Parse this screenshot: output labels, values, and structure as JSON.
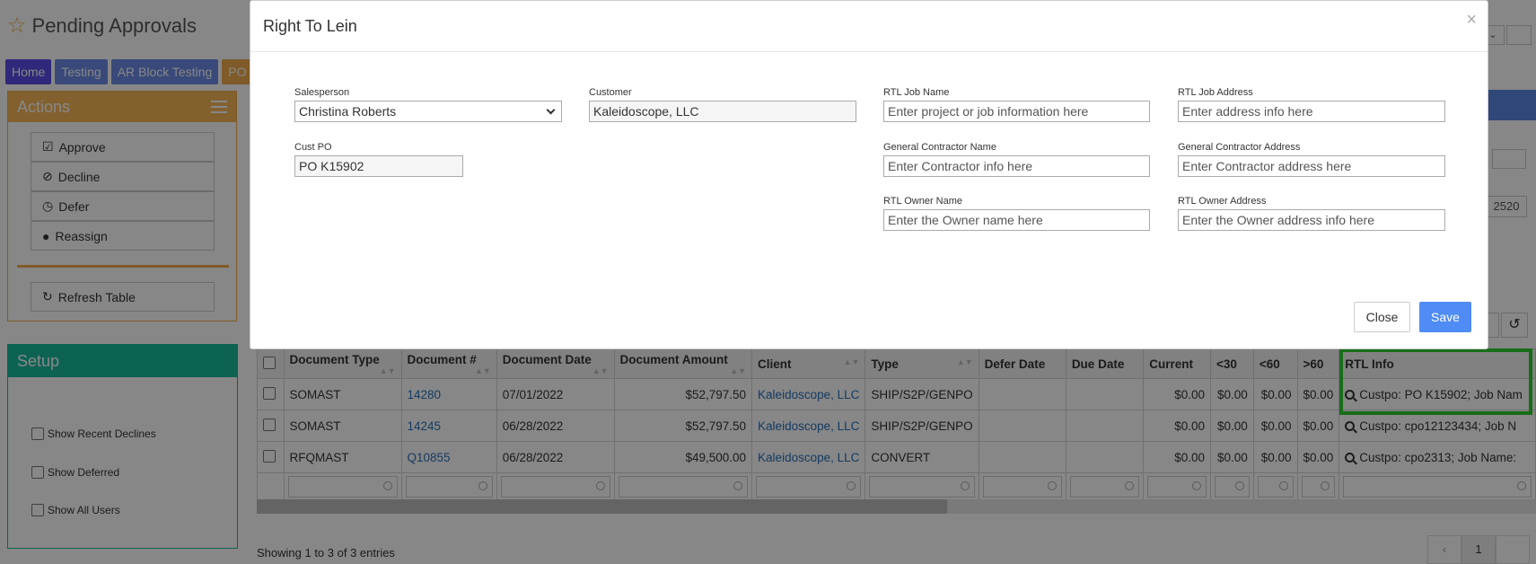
{
  "page": {
    "title": "Pending Approvals",
    "tabs": [
      "Home",
      "Testing",
      "AR Block Testing",
      "PO B"
    ]
  },
  "actions": {
    "title": "Actions",
    "approve": "Approve",
    "decline": "Decline",
    "defer": "Defer",
    "reassign": "Reassign",
    "refresh": "Refresh Table"
  },
  "setup": {
    "title": "Setup",
    "show_recent_declines": "Show Recent Declines",
    "show_deferred": "Show Deferred",
    "show_all_users": "Show All Users"
  },
  "side": {
    "number": "2520"
  },
  "table": {
    "headers": [
      "Document Type",
      "Document #",
      "Document Date",
      "Document Amount",
      "Client",
      "Type",
      "Defer Date",
      "Due Date",
      "Current",
      "<30",
      "<60",
      ">60",
      "RTL Info"
    ],
    "rows": [
      {
        "doc_type": "SOMAST",
        "doc_num": "14280",
        "doc_date": "07/01/2022",
        "amount": "$52,797.50",
        "client": "Kaleidoscope, LLC",
        "type": "SHIP/S2P/GENPO",
        "defer": "",
        "due": "",
        "current": "$0.00",
        "lt30": "$0.00",
        "lt60": "$0.00",
        "gt60": "$0.00",
        "rtl": "Custpo: PO K15902; Job Nam"
      },
      {
        "doc_type": "SOMAST",
        "doc_num": "14245",
        "doc_date": "06/28/2022",
        "amount": "$52,797.50",
        "client": "Kaleidoscope, LLC",
        "type": "SHIP/S2P/GENPO",
        "defer": "",
        "due": "",
        "current": "$0.00",
        "lt30": "$0.00",
        "lt60": "$0.00",
        "gt60": "$0.00",
        "rtl": "Custpo: cpo12123434; Job N"
      },
      {
        "doc_type": "RFQMAST",
        "doc_num": "Q10855",
        "doc_date": "06/28/2022",
        "amount": "$49,500.00",
        "client": "Kaleidoscope, LLC",
        "type": "CONVERT",
        "defer": "",
        "due": "",
        "current": "$0.00",
        "lt30": "$0.00",
        "lt60": "$0.00",
        "gt60": "$0.00",
        "rtl": "Custpo: cpo2313; Job Name:"
      }
    ],
    "showing": "Showing 1 to 3 of 3 entries",
    "page": "1"
  },
  "modal": {
    "title": "Right To Lein",
    "close_x": "×",
    "salesperson_label": "Salesperson",
    "salesperson_value": "Christina Roberts",
    "customer_label": "Customer",
    "customer_value": "Kaleidoscope, LLC",
    "custpo_label": "Cust PO",
    "custpo_value": "PO K15902",
    "job_name_label": "RTL Job Name",
    "job_name_placeholder": "Enter project or job information here",
    "job_address_label": "RTL Job Address",
    "job_address_placeholder": "Enter address info here",
    "gc_name_label": "General Contractor Name",
    "gc_name_placeholder": "Enter Contractor info here",
    "gc_address_label": "General Contractor Address",
    "gc_address_placeholder": "Enter Contractor address here",
    "owner_name_label": "RTL Owner Name",
    "owner_name_placeholder": "Enter the Owner name here",
    "owner_address_label": "RTL Owner Address",
    "owner_address_placeholder": "Enter the Owner address info here",
    "close_button": "Close",
    "save_button": "Save"
  },
  "colors": {
    "home_tab": "#5a4de8",
    "tab": "#6c8ae4",
    "actions_orange": "#f6b85a",
    "setup_teal": "#1abc9c",
    "save_blue": "#4f8cf5",
    "highlight_green": "#2fce2f"
  }
}
